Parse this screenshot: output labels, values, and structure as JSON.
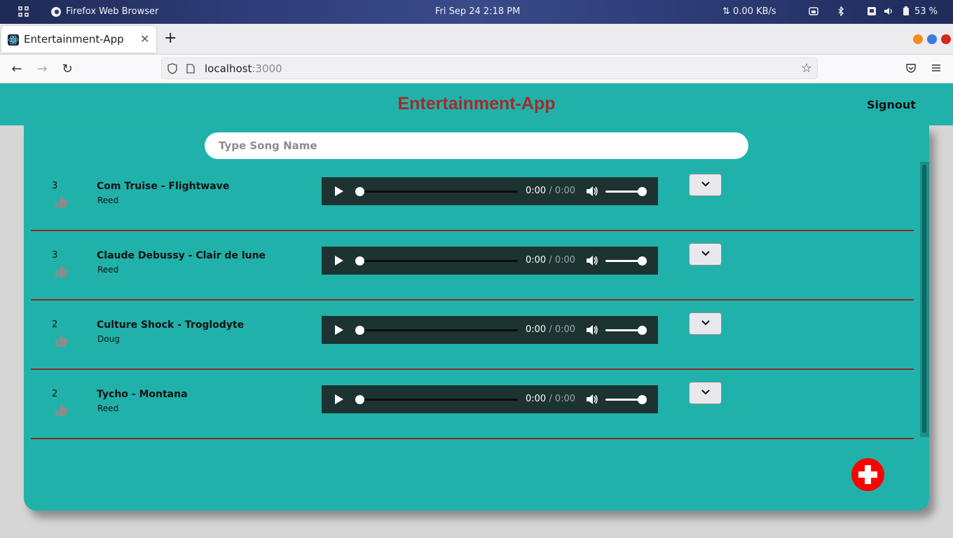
{
  "os": {
    "app_name": "Firefox Web Browser",
    "datetime": "Fri Sep 24  2:18 PM",
    "net_speed": "⇅ 0.00 KB/s",
    "battery": "53 %"
  },
  "browser": {
    "tab_title": "Entertainment-App",
    "url_host": "localhost",
    "url_port": ":3000"
  },
  "app": {
    "title": "Entertainment-App",
    "signout_label": "Signout",
    "search_placeholder": "Type Song Name",
    "colors": {
      "background": "#20b2aa",
      "title": "#a52a2a",
      "divider": "#8b2a1e",
      "add_button": "#ff0000"
    }
  },
  "songs": [
    {
      "likes": "3",
      "title": "Com Truise - Flightwave",
      "artist": "Reed",
      "time_current": "0:00",
      "time_total": "0:00"
    },
    {
      "likes": "3",
      "title": "Claude Debussy - Clair de lune",
      "artist": "Reed",
      "time_current": "0:00",
      "time_total": "0:00"
    },
    {
      "likes": "2",
      "title": "Culture Shock - Troglodyte",
      "artist": "Doug",
      "time_current": "0:00",
      "time_total": "0:00"
    },
    {
      "likes": "2",
      "title": "Tycho - Montana",
      "artist": "Reed",
      "time_current": "0:00",
      "time_total": "0:00"
    }
  ]
}
